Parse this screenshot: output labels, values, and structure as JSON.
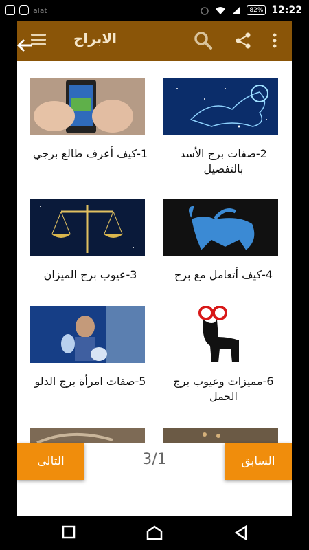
{
  "status_bar": {
    "left_text": "alat",
    "battery": "82%",
    "time": "12:22"
  },
  "toolbar": {
    "title": "الابراج",
    "icons": [
      "menu-icon",
      "search-icon",
      "share-icon",
      "more-vert-icon"
    ]
  },
  "items": [
    {
      "label": "1-كيف أعرف طالع برجي",
      "image": "phone-in-hand"
    },
    {
      "label": "2-صفات برج الأسد بالتفصيل",
      "image": "leo-constellation"
    },
    {
      "label": "3-عيوب برج الميزان",
      "image": "libra-scales"
    },
    {
      "label": "4-كيف أتعامل مع برج",
      "image": "taurus-bull"
    },
    {
      "label": "5-صفات امرأة برج الدلو",
      "image": "aquarius-figure"
    },
    {
      "label": "6-مميزات وعيوب برج الحمل",
      "image": "aries-ram"
    }
  ],
  "pager": {
    "next_label": "التالى",
    "prev_label": "السابق",
    "page": "3/1"
  },
  "colors": {
    "toolbar": "#8a5508",
    "button": "#f08d0c"
  }
}
